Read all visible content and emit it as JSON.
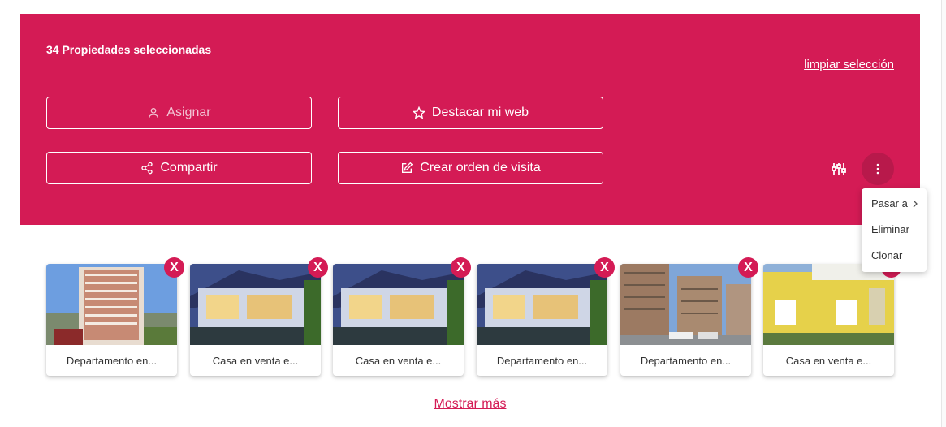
{
  "selection": {
    "count_label": "34 Propiedades seleccionadas",
    "clear_label": "limpiar selección"
  },
  "actions": {
    "assign_label": "Asignar",
    "feature_label": "Destacar mi web",
    "share_label": "Compartir",
    "visit_order_label": "Crear orden de visita"
  },
  "menu": {
    "items": [
      "Pasar a",
      "Eliminar",
      "Clonar"
    ]
  },
  "cards": [
    {
      "title": "Departamento en...",
      "remove_label": "X"
    },
    {
      "title": "Casa en venta e...",
      "remove_label": "X"
    },
    {
      "title": "Casa en venta e...",
      "remove_label": "X"
    },
    {
      "title": "Departamento en...",
      "remove_label": "X"
    },
    {
      "title": "Departamento en...",
      "remove_label": "X"
    },
    {
      "title": "Casa en venta e...",
      "remove_label": "X"
    }
  ],
  "show_more_label": "Mostrar más",
  "colors": {
    "brand": "#d41b55",
    "white": "#ffffff"
  }
}
